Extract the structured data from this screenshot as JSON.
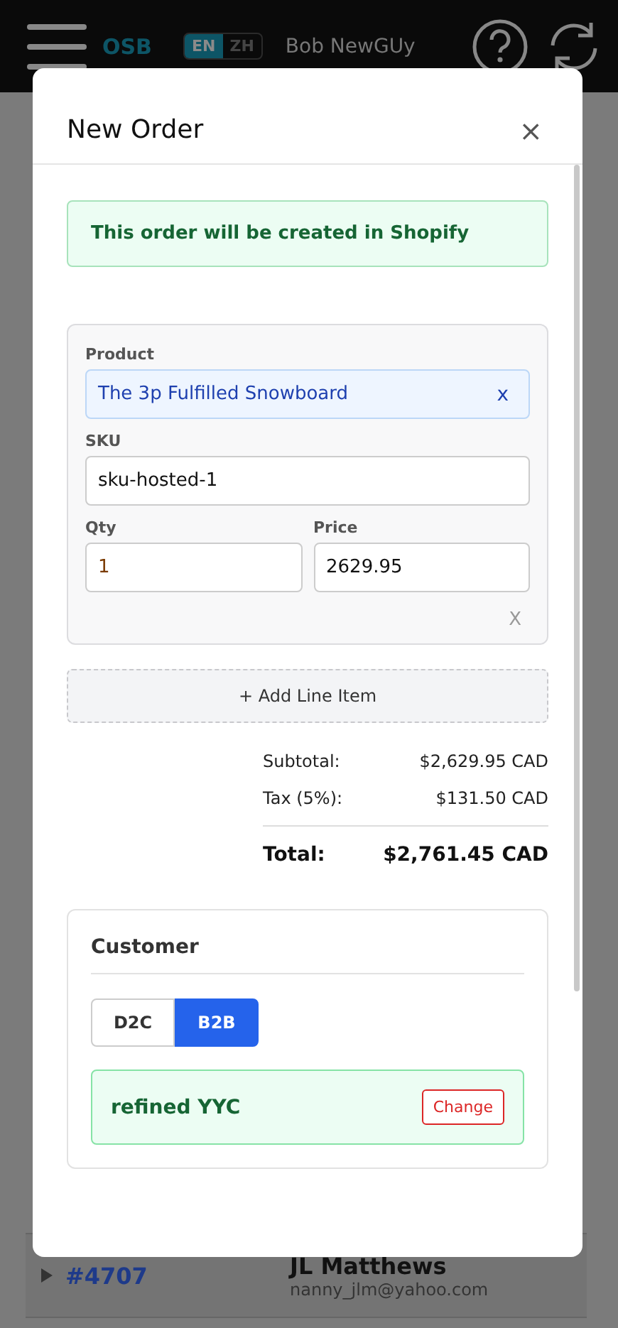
{
  "header": {
    "logo": "OSB",
    "languages": [
      {
        "label": "EN",
        "selected": true
      },
      {
        "label": "ZH",
        "selected": false
      }
    ],
    "user": "Bob NewGUy"
  },
  "background_row": {
    "order": "#4707",
    "name": "JL Matthews",
    "email": "nanny_jlm@yahoo.com"
  },
  "modal": {
    "title": "New Order",
    "close": "×",
    "notice": "This order will be created in Shopify",
    "line_items": [
      {
        "product_label": "Product",
        "product": "The 3p Fulfilled Snowboard",
        "product_clear": "x",
        "sku_label": "SKU",
        "sku": "sku-hosted-1",
        "qty_label": "Qty",
        "qty": "1",
        "price_label": "Price",
        "price": "2629.95",
        "remove": "X"
      }
    ],
    "add_button": "+ Add Line Item",
    "totals": [
      {
        "label": "Subtotal:",
        "value": "$2,629.95 CAD",
        "kind": "line"
      },
      {
        "label": "Tax (5%):",
        "value": "$131.50 CAD",
        "kind": "line"
      },
      {
        "label": "Total:",
        "value": "$2,761.45 CAD",
        "kind": "total"
      }
    ],
    "customer": {
      "title": "Customer",
      "types": [
        {
          "label": "D2C",
          "selected": false
        },
        {
          "label": "B2B",
          "selected": true
        }
      ],
      "selected_name": "refined YYC",
      "change_button": "Change"
    }
  }
}
